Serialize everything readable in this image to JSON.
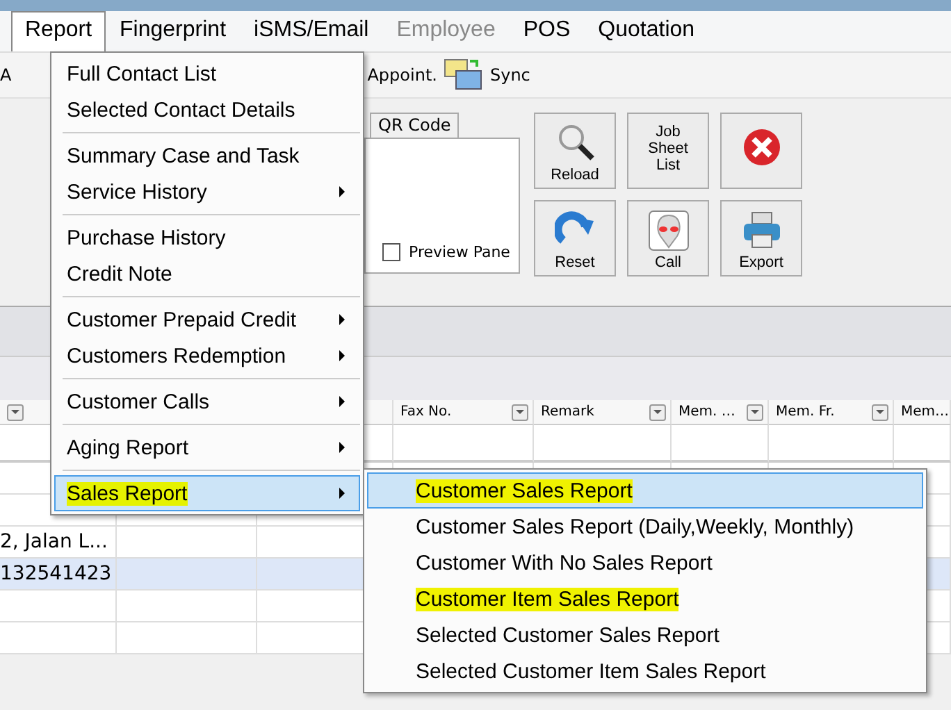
{
  "menu_bar": [
    {
      "label": "Report",
      "selected": true,
      "disabled": false
    },
    {
      "label": "Fingerprint",
      "selected": false,
      "disabled": false
    },
    {
      "label": "iSMS/Email",
      "selected": false,
      "disabled": false
    },
    {
      "label": "Employee",
      "selected": false,
      "disabled": true
    },
    {
      "label": "POS",
      "selected": false,
      "disabled": false
    },
    {
      "label": "Quotation",
      "selected": false,
      "disabled": false
    }
  ],
  "toolbar": [
    {
      "label": "A",
      "kind": "text"
    },
    {
      "label": "Appoint.",
      "kind": "text"
    },
    {
      "label": "Sync",
      "kind": "sync"
    }
  ],
  "tabs": [
    {
      "label": "QR Code",
      "selected": false
    }
  ],
  "preview_pane": {
    "label": "Preview Pane",
    "checked": false
  },
  "buttons": [
    {
      "label": "Reload",
      "kind": "search"
    },
    {
      "label": "Job Sheet List",
      "kind": "text"
    },
    {
      "kind": "close"
    },
    {
      "label": "Reset",
      "kind": "redo"
    },
    {
      "label": "Call",
      "kind": "alien"
    },
    {
      "label": "Export",
      "kind": "print"
    }
  ],
  "table": {
    "columns": [
      "",
      "",
      "",
      "Fax No.",
      "Remark",
      "Mem. …",
      "Mem. Fr.",
      "Mem…"
    ],
    "rows": [
      {
        "cells": [
          "",
          "",
          "",
          "",
          "",
          "",
          "",
          ""
        ],
        "selected": false
      },
      {
        "cells": [
          "",
          "",
          "",
          "",
          "",
          "",
          "",
          ""
        ],
        "selected": false
      },
      {
        "cells": [
          "2, Jalan L...",
          "",
          "",
          "",
          "",
          "",
          "",
          ""
        ],
        "selected": false
      },
      {
        "cells": [
          "132541423",
          "",
          "",
          "",
          "",
          "",
          "",
          ""
        ],
        "selected": true
      },
      {
        "cells": [
          "",
          "",
          "",
          "",
          "",
          "",
          "",
          ""
        ],
        "selected": false
      },
      {
        "cells": [
          "",
          "",
          "",
          "",
          "",
          "",
          "",
          ""
        ],
        "selected": false
      }
    ]
  },
  "report_menu": {
    "items": [
      {
        "kind": "item",
        "label": "Full Contact List",
        "submenu": false,
        "selected": false,
        "highlighted": false
      },
      {
        "kind": "item",
        "label": "Selected Contact Details",
        "submenu": false,
        "selected": false,
        "highlighted": false
      },
      {
        "kind": "separator"
      },
      {
        "kind": "item",
        "label": "Summary Case and Task",
        "submenu": false,
        "selected": false,
        "highlighted": false
      },
      {
        "kind": "item",
        "label": "Service History",
        "submenu": true,
        "selected": false,
        "highlighted": false
      },
      {
        "kind": "separator"
      },
      {
        "kind": "item",
        "label": "Purchase History",
        "submenu": false,
        "selected": false,
        "highlighted": false
      },
      {
        "kind": "item",
        "label": "Credit Note",
        "submenu": false,
        "selected": false,
        "highlighted": false
      },
      {
        "kind": "separator"
      },
      {
        "kind": "item",
        "label": "Customer Prepaid Credit",
        "submenu": true,
        "selected": false,
        "highlighted": false
      },
      {
        "kind": "item",
        "label": "Customers Redemption",
        "submenu": true,
        "selected": false,
        "highlighted": false
      },
      {
        "kind": "separator"
      },
      {
        "kind": "item",
        "label": "Customer Calls",
        "submenu": true,
        "selected": false,
        "highlighted": false
      },
      {
        "kind": "separator"
      },
      {
        "kind": "item",
        "label": "Aging Report",
        "submenu": true,
        "selected": false,
        "highlighted": false
      },
      {
        "kind": "separator"
      },
      {
        "kind": "item",
        "label": "Sales Report",
        "submenu": true,
        "selected": true,
        "highlighted": true
      }
    ]
  },
  "sales_submenu": {
    "items": [
      {
        "kind": "item",
        "label": "Customer Sales Report",
        "submenu": false,
        "selected": true,
        "highlighted": true
      },
      {
        "kind": "item",
        "label": "Customer Sales Report (Daily,Weekly, Monthly)",
        "submenu": false,
        "selected": false,
        "highlighted": false
      },
      {
        "kind": "item",
        "label": "Customer With No Sales Report",
        "submenu": false,
        "selected": false,
        "highlighted": false
      },
      {
        "kind": "item",
        "label": "Customer Item Sales Report",
        "submenu": false,
        "selected": false,
        "highlighted": true
      },
      {
        "kind": "item",
        "label": "Selected Customer Sales Report",
        "submenu": false,
        "selected": false,
        "highlighted": false
      },
      {
        "kind": "item",
        "label": "Selected Customer Item Sales Report",
        "submenu": false,
        "selected": false,
        "highlighted": false
      }
    ]
  }
}
